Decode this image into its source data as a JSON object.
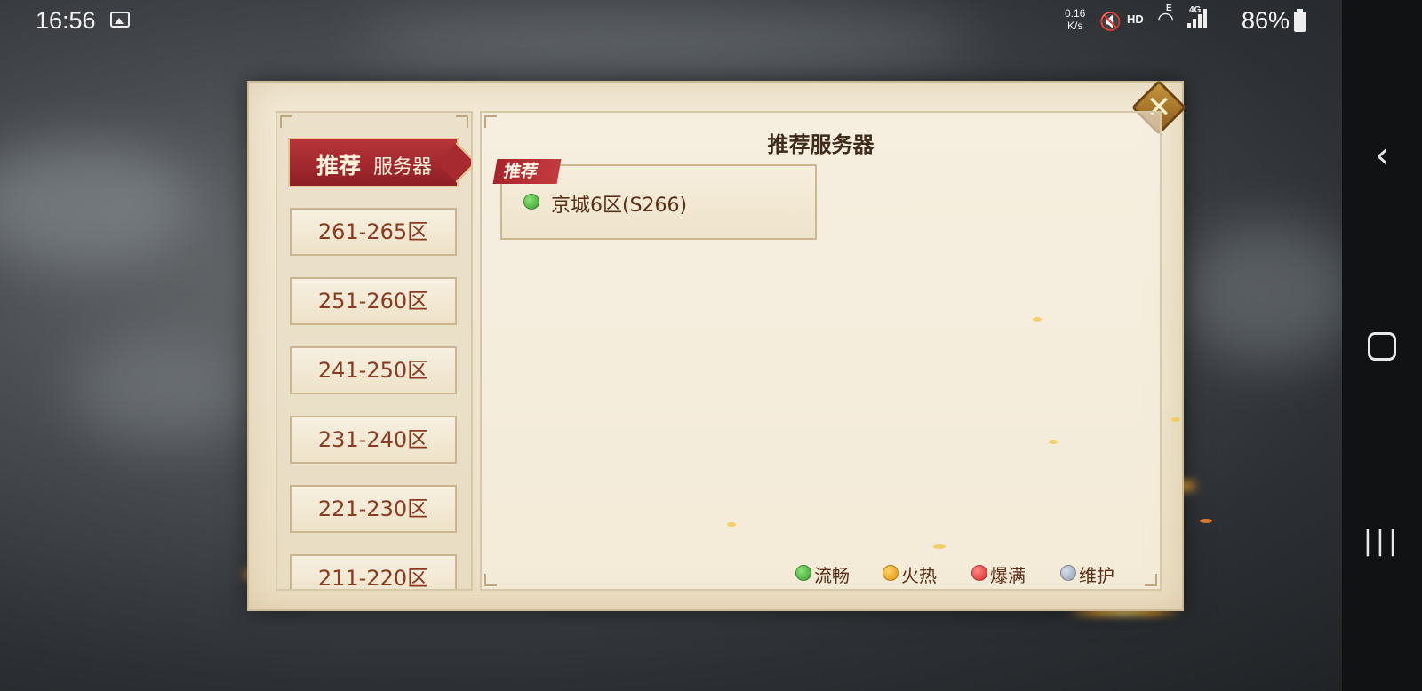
{
  "status_bar": {
    "time": "16:56",
    "net_speed_value": "0.16",
    "net_speed_unit": "K/s",
    "hd_label": "HD",
    "network_type": "4G",
    "signal_letter": "E",
    "battery": "86%"
  },
  "dialog": {
    "title": "推荐服务器",
    "tabs": {
      "active": {
        "label_bold": "推荐",
        "label_rest": "服务器"
      },
      "ranges": [
        "261-265区",
        "251-260区",
        "241-250区",
        "231-240区",
        "221-230区",
        "211-220区"
      ]
    },
    "recommended": {
      "badge": "推荐",
      "server_name": "京城6区(S266)",
      "status": "green"
    },
    "legend": [
      {
        "label": "流畅",
        "color": "green"
      },
      {
        "label": "火热",
        "color": "orange"
      },
      {
        "label": "爆满",
        "color": "red"
      },
      {
        "label": "维护",
        "color": "gray"
      }
    ],
    "close_icon": "close-x-icon"
  },
  "colors": {
    "accent_red": "#a7232b",
    "text_brown": "#5b2e16",
    "parchment": "#f2e9d6"
  }
}
